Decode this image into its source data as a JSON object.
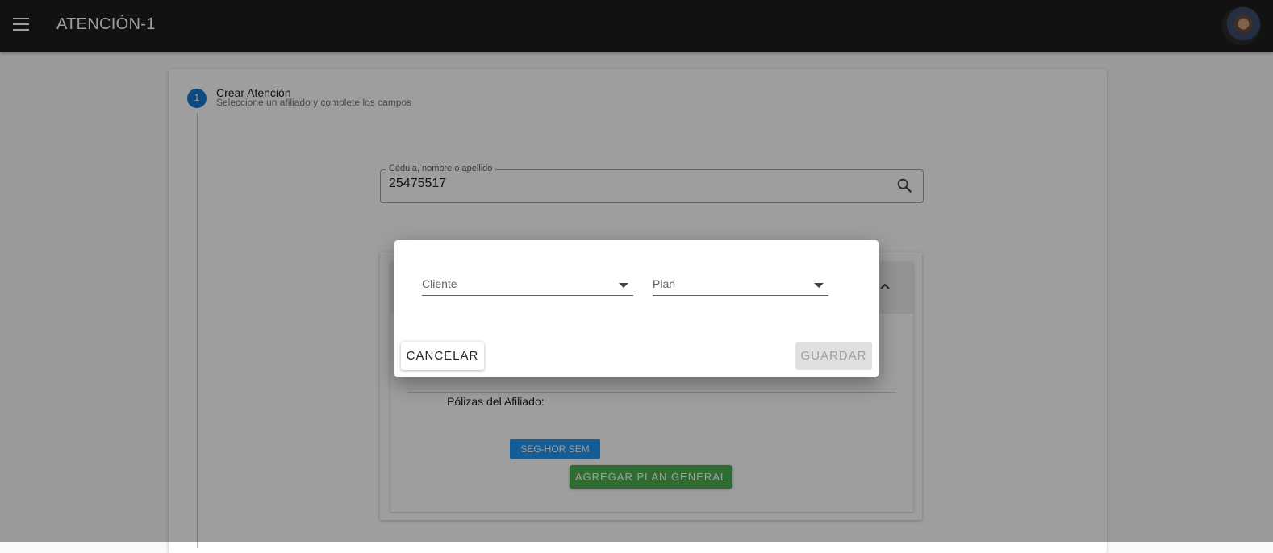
{
  "app": {
    "title": "ATENCIÓN-1"
  },
  "icons": {
    "menu": "menu-icon",
    "search": "search-icon",
    "chevron": "chevron-up-icon",
    "caret": "caret-down-icon"
  },
  "stepper": {
    "step_number": "1",
    "title": "Crear Atención",
    "subtitle": "Seleccione un afiliado y complete los campos"
  },
  "search": {
    "label": "Cédula, nombre o apellido",
    "value": "25475517"
  },
  "affiliate_card": {
    "policies_label": "Pólizas del Afiliado:",
    "policy_chip": "SEG-HOR SEM",
    "add_plan_button": "AGREGAR PLAN GENERAL"
  },
  "dialog": {
    "client_select": {
      "label": "Cliente"
    },
    "plan_select": {
      "label": "Plan"
    },
    "cancel_button": "CANCELAR",
    "save_button": "GUARDAR"
  },
  "colors": {
    "appbar": "#1e1e1e",
    "accent_blue": "#2196f3",
    "step_blue": "#1976d2",
    "green": "#4caf50",
    "overlay": "rgba(0,0,0,0.38)"
  }
}
